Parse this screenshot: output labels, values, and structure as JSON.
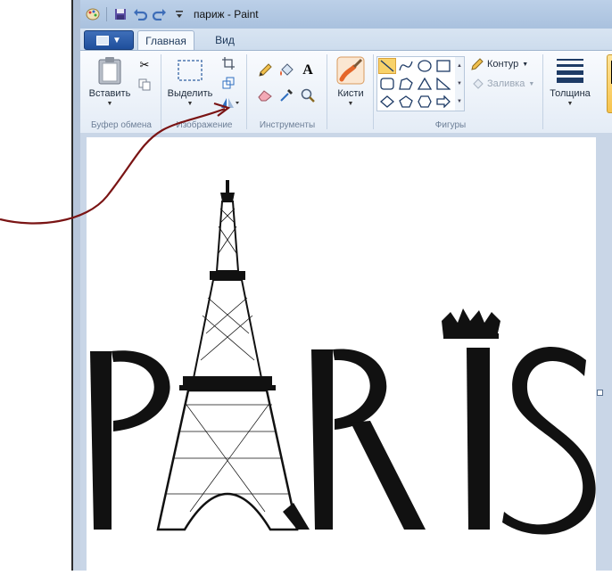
{
  "window": {
    "title": "париж - Paint"
  },
  "quick_access": {
    "icons": [
      "paint-app-icon",
      "save-icon",
      "undo-icon",
      "redo-icon",
      "customize-dropdown-icon"
    ]
  },
  "tabs": {
    "file_menu": "file-menu-icon",
    "home": "Главная",
    "view": "Вид"
  },
  "ribbon": {
    "clipboard": {
      "group_label": "Буфер обмена",
      "paste_label": "Вставить"
    },
    "image": {
      "group_label": "Изображение",
      "select_label": "Выделить"
    },
    "tools": {
      "group_label": "Инструменты",
      "text_glyph": "A"
    },
    "brushes": {
      "label": "Кисти"
    },
    "shapes": {
      "group_label": "Фигуры",
      "outline_label": "Контур",
      "fill_label": "Заливка"
    },
    "size": {
      "label": "Толщина"
    }
  },
  "canvas": {
    "artwork_text": "PARIS"
  },
  "colors": {
    "ribbon_bg": "#e4ecf6",
    "accent_file": "#1f4f9c",
    "selected_shape": "#f8d26a",
    "annotation_arrow": "#7a1414"
  }
}
